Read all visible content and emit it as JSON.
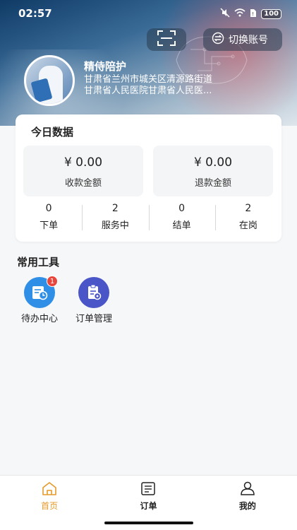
{
  "status_bar": {
    "time": "02:57",
    "battery": "100"
  },
  "header": {
    "switch_account_label": "切换账号",
    "org_name": "精侍陪护",
    "address": "甘肃省兰州市城关区清源路街道",
    "hospital": "甘肃省人民医院甘肃省人民医..."
  },
  "today": {
    "title": "今日数据",
    "receipt": {
      "value": "¥ 0.00",
      "label": "收款金额"
    },
    "refund": {
      "value": "¥ 0.00",
      "label": "退款金额"
    },
    "stats": [
      {
        "num": "0",
        "label": "下单"
      },
      {
        "num": "2",
        "label": "服务中"
      },
      {
        "num": "0",
        "label": "结单"
      },
      {
        "num": "2",
        "label": "在岗"
      }
    ]
  },
  "tools": {
    "title": "常用工具",
    "items": [
      {
        "label": "待办中心",
        "badge": "1",
        "icon": "todo-center-icon",
        "color": "#2f8fe6"
      },
      {
        "label": "订单管理",
        "icon": "order-management-icon",
        "color": "#4a56c8"
      }
    ]
  },
  "tabbar": {
    "items": [
      {
        "label": "首页",
        "icon": "home-icon",
        "active": true
      },
      {
        "label": "订单",
        "icon": "order-icon"
      },
      {
        "label": "我的",
        "icon": "profile-icon"
      }
    ],
    "active_color": "#e59a2a"
  }
}
